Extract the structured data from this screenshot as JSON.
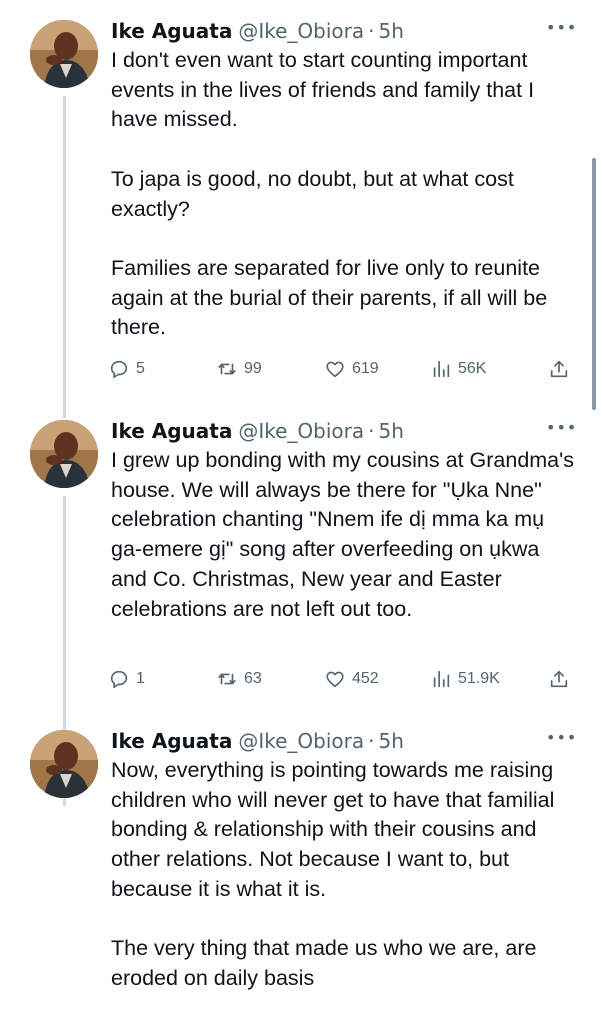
{
  "tweets": [
    {
      "name": "Ike Aguata",
      "handle": "@Ike_Obiora",
      "separator": "·",
      "time": "5h",
      "more_icon": "more-horizontal-icon",
      "paragraphs": [
        "I don't even want to start counting important events in the lives of friends and family that I have missed.",
        "To japa is good, no doubt, but at what cost exactly?",
        "Families are separated for live only to reunite again at the burial of their parents, if all will be there."
      ],
      "replies": "5",
      "retweets": "99",
      "likes": "619",
      "views": "56K"
    },
    {
      "name": "Ike Aguata",
      "handle": "@Ike_Obiora",
      "separator": "·",
      "time": "5h",
      "more_icon": "more-horizontal-icon",
      "paragraphs": [
        "I grew up bonding with my cousins at Grandma's house. We will always be there for \"Ụka Nne\" celebration chanting \"Nnem ife dị mma ka mụ ga-emere gị\" song after overfeeding on ụkwa and Co. Christmas, New year and Easter celebrations are not left out too."
      ],
      "replies": "1",
      "retweets": "63",
      "likes": "452",
      "views": "51.9K"
    },
    {
      "name": "Ike Aguata",
      "handle": "@Ike_Obiora",
      "separator": "·",
      "time": "5h",
      "more_icon": "more-horizontal-icon",
      "paragraphs": [
        "Now, everything is pointing towards me raising children who will never get to have that familial bonding & relationship with their cousins and other relations. Not because I want to, but because it is what it is.",
        "The very thing that made us who we are, are eroded on daily basis"
      ]
    }
  ],
  "icons": {
    "reply": "reply-icon",
    "retweet": "retweet-icon",
    "like": "like-icon",
    "views": "views-icon",
    "share": "share-icon"
  },
  "colors": {
    "text": "#0f1419",
    "secondary": "#536471",
    "thread_line": "#cfd9de"
  }
}
